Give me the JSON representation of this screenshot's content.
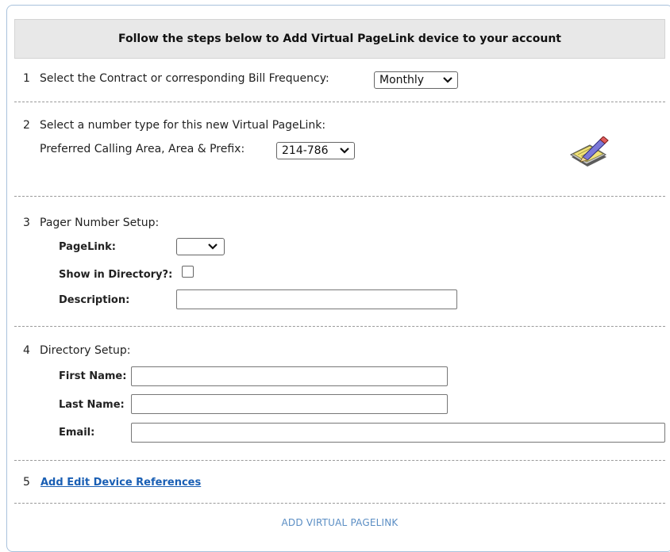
{
  "header": {
    "title": "Follow the steps below to Add Virtual PageLink device to your account"
  },
  "step1": {
    "num": "1",
    "text": "Select the Contract or corresponding Bill Frequency:",
    "select_value": "Monthly"
  },
  "step2": {
    "num": "2",
    "text": "Select a number type for this new Virtual PageLink:",
    "area_label": "Preferred Calling Area, Area & Prefix:",
    "area_value": "214-786"
  },
  "step3": {
    "num": "3",
    "text": "Pager Number Setup:",
    "pagelink_label": "PageLink:",
    "pagelink_value": "",
    "directory_label": "Show in Directory?:",
    "description_label": "Description:",
    "description_value": ""
  },
  "step4": {
    "num": "4",
    "text": "Directory Setup:",
    "first_label": "First Name:",
    "first_value": "",
    "last_label": "Last Name:",
    "last_value": "",
    "email_label": "Email:",
    "email_value": ""
  },
  "step5": {
    "num": "5",
    "link": "Add Edit Device References"
  },
  "submit_label": "ADD VIRTUAL PAGELINK",
  "icons": {
    "edit": "edit-pencil-notepad-icon",
    "chevron": "chevron-down-icon"
  },
  "colors": {
    "link": "#1a5fb4",
    "submit": "#5b8ec4",
    "header_bg": "#e8e8e8",
    "frame_border": "#a9c2dc"
  }
}
